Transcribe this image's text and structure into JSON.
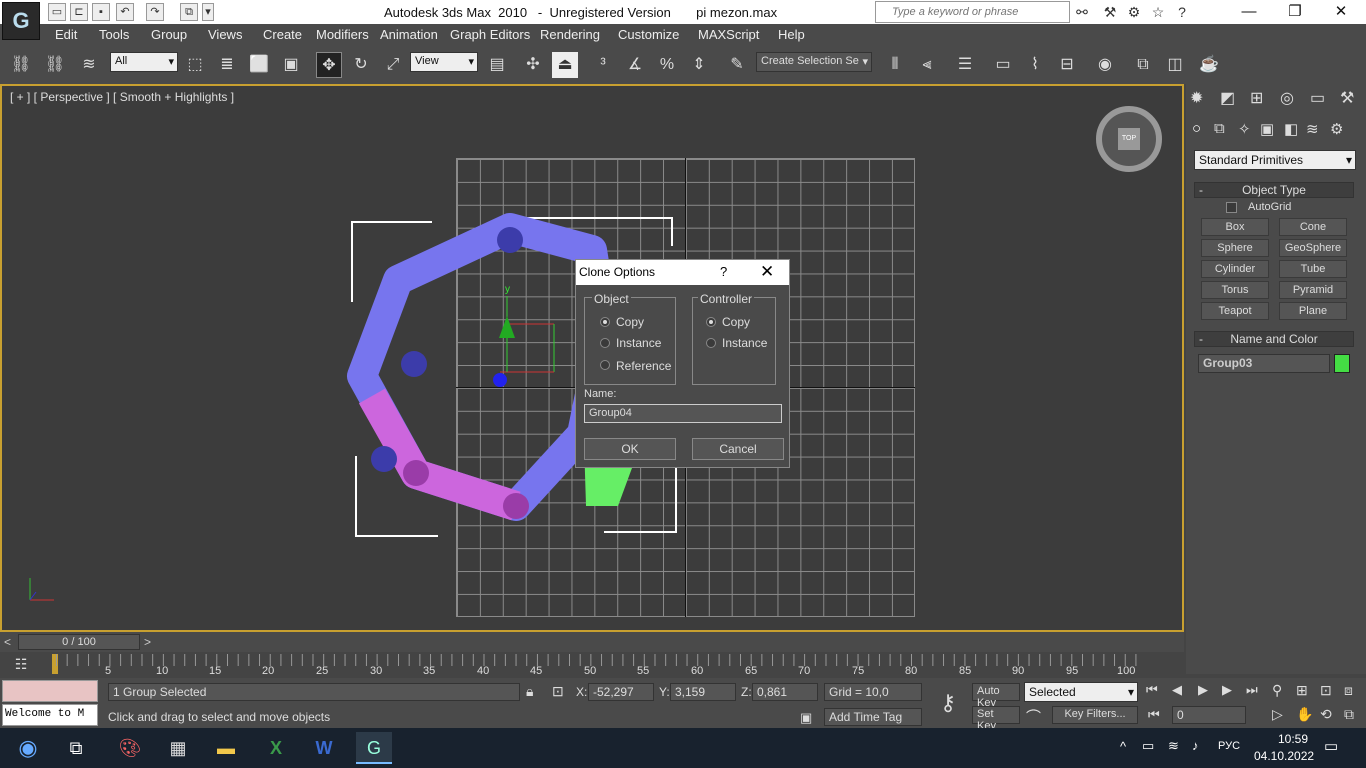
{
  "window": {
    "title": "Autodesk 3ds Max  2010   -  Unregistered Version       pi mezon.max",
    "search_placeholder": "Type a keyword or phrase",
    "app_logo": "G"
  },
  "menu": [
    "Edit",
    "Tools",
    "Group",
    "Views",
    "Create",
    "Modifiers",
    "Animation",
    "Graph Editors",
    "Rendering",
    "Customize",
    "MAXScript",
    "Help"
  ],
  "toolbar": {
    "filter_value": "All",
    "ref_coord_value": "View",
    "named_selection_value": "Create Selection Se"
  },
  "viewport": {
    "label": "[ + ] [ Perspective ] [ Smooth + Highlights ]",
    "viewcube_label": "TOP",
    "gizmo_axis": "y"
  },
  "dialog": {
    "title": "Clone Options",
    "help": "?",
    "object_group": "Object",
    "object_options": [
      "Copy",
      "Instance",
      "Reference"
    ],
    "object_selected": "Copy",
    "controller_group": "Controller",
    "controller_options": [
      "Copy",
      "Instance"
    ],
    "controller_selected": "Copy",
    "name_label": "Name:",
    "name_value": "Group04",
    "ok": "OK",
    "cancel": "Cancel"
  },
  "command_panel": {
    "category": "Standard Primitives",
    "object_type_title": "Object Type",
    "autogrid": "AutoGrid",
    "buttons": [
      "Box",
      "Cone",
      "Sphere",
      "GeoSphere",
      "Cylinder",
      "Tube",
      "Torus",
      "Pyramid",
      "Teapot",
      "Plane"
    ],
    "name_color_title": "Name and Color",
    "object_name": "Group03",
    "object_color": "#44dd44"
  },
  "timeline": {
    "frame_display": "0 / 100",
    "ticks": [
      "5",
      "10",
      "15",
      "20",
      "25",
      "30",
      "35",
      "40",
      "45",
      "50",
      "55",
      "60",
      "65",
      "70",
      "75",
      "80",
      "85",
      "90",
      "95",
      "100"
    ]
  },
  "status": {
    "selection_info": "1 Group Selected",
    "prompt": "Click and drag to select and move objects",
    "maxscript_listener": "Welcome to M",
    "x_label": "X:",
    "x_value": "-52,297",
    "y_label": "Y:",
    "y_value": "3,159",
    "z_label": "Z:",
    "z_value": "0,861",
    "grid": "Grid = 10,0",
    "add_time_tag": "Add Time Tag",
    "auto_key": "Auto Key",
    "set_key": "Set Key",
    "selected_dropdown": "Selected",
    "key_filters": "Key Filters...",
    "frame_field": "0"
  },
  "taskbar": {
    "lang": "РУС",
    "time": "10:59",
    "date": "04.10.2022"
  }
}
